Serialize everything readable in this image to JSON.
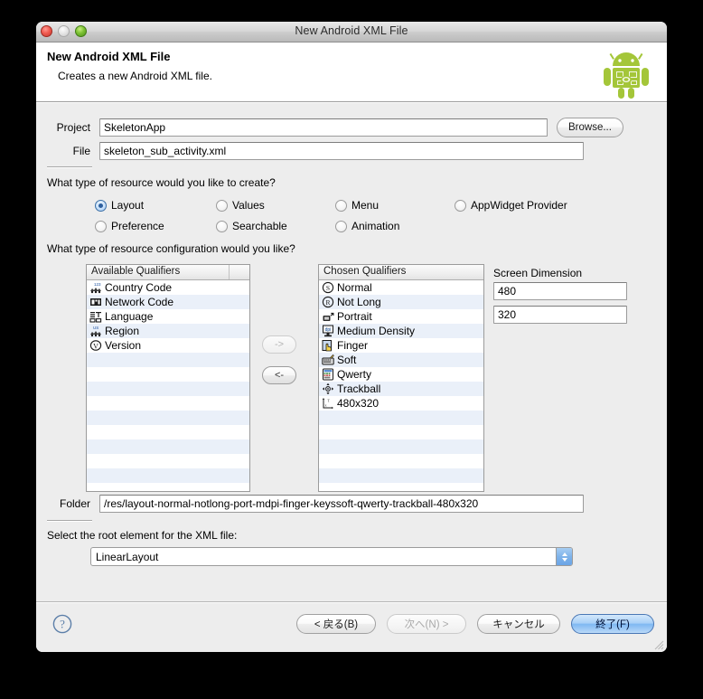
{
  "window": {
    "title": "New Android XML File",
    "traffic_lights": [
      "close-red",
      "minimize-grey",
      "zoom-green"
    ]
  },
  "header": {
    "title": "New Android XML File",
    "subtitle": "Creates a new Android XML file.",
    "logo": "android-robot-logo"
  },
  "form": {
    "project_label": "Project",
    "project_value": "SkeletonApp",
    "browse_label": "Browse...",
    "file_label": "File",
    "file_value": "skeleton_sub_activity.xml"
  },
  "resource_type": {
    "question": "What type of resource would you like to create?",
    "options": [
      {
        "label": "Layout",
        "selected": true
      },
      {
        "label": "Values",
        "selected": false
      },
      {
        "label": "Menu",
        "selected": false
      },
      {
        "label": "AppWidget Provider",
        "selected": false
      },
      {
        "label": "Preference",
        "selected": false
      },
      {
        "label": "Searchable",
        "selected": false
      },
      {
        "label": "Animation",
        "selected": false
      }
    ]
  },
  "configuration": {
    "question": "What type of resource configuration would you like?",
    "available": {
      "header": "Available Qualifiers",
      "header_extra": "",
      "items": [
        {
          "label": "Country Code",
          "icon": "country-code-icon"
        },
        {
          "label": "Network Code",
          "icon": "network-code-icon"
        },
        {
          "label": "Language",
          "icon": "language-icon"
        },
        {
          "label": "Region",
          "icon": "region-icon"
        },
        {
          "label": "Version",
          "icon": "version-icon"
        }
      ]
    },
    "chosen": {
      "header": "Chosen Qualifiers",
      "items": [
        {
          "label": "Normal",
          "icon": "screen-size-icon"
        },
        {
          "label": "Not Long",
          "icon": "screen-ratio-icon"
        },
        {
          "label": "Portrait",
          "icon": "orientation-icon"
        },
        {
          "label": "Medium Density",
          "icon": "density-icon"
        },
        {
          "label": "Finger",
          "icon": "touch-icon"
        },
        {
          "label": "Soft",
          "icon": "keyboard-state-icon"
        },
        {
          "label": "Qwerty",
          "icon": "text-input-icon"
        },
        {
          "label": "Trackball",
          "icon": "navigation-icon"
        },
        {
          "label": "480x320",
          "icon": "screen-dimension-icon"
        }
      ]
    },
    "add_button": "->",
    "remove_button": "<-",
    "screen_dimension": {
      "label": "Screen Dimension",
      "width": "480",
      "height": "320"
    }
  },
  "folder": {
    "label": "Folder",
    "value": "/res/layout-normal-notlong-port-mdpi-finger-keyssoft-qwerty-trackball-480x320"
  },
  "root_element": {
    "label": "Select the root element for the XML file:",
    "value": "LinearLayout"
  },
  "footer": {
    "help": "?",
    "back": "< 戻る(B)",
    "next": "次へ(N) >",
    "cancel": "キャンセル",
    "finish": "終了(F)"
  },
  "colors": {
    "dialog_bg": "#ededed",
    "list_alt_row": "#eaf0f9",
    "android_green": "#a4c639",
    "default_button_blue": "#7fb8f2"
  }
}
